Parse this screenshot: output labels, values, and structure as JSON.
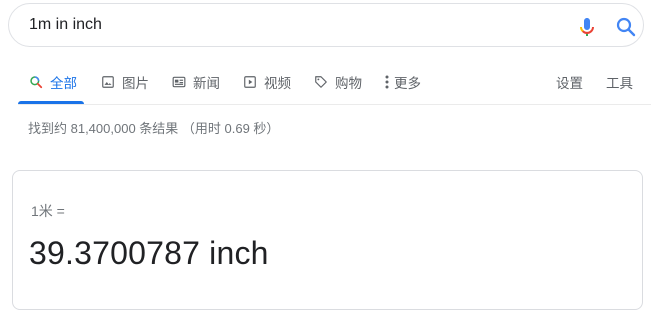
{
  "search": {
    "query": "1m in inch"
  },
  "tabs": [
    {
      "label": "全部",
      "icon": "search-icon",
      "active": true
    },
    {
      "label": "图片",
      "icon": "image-icon"
    },
    {
      "label": "新闻",
      "icon": "news-icon"
    },
    {
      "label": "视频",
      "icon": "video-icon"
    },
    {
      "label": "购物",
      "icon": "tag-icon"
    },
    {
      "label": "更多",
      "icon": "more-vert-icon"
    }
  ],
  "tools": {
    "settings": "设置",
    "tools": "工具"
  },
  "result_stats": "找到约 81,400,000 条结果 （用时 0.69 秒）",
  "converter": {
    "from": "1米 =",
    "result": "39.3700787 inch"
  },
  "colors": {
    "accent": "#1a73e8",
    "text": "#202124",
    "muted": "#70757a",
    "mic_blue": "#4285f4",
    "mic_red": "#ea4335",
    "mic_yellow": "#fbbc05",
    "mic_green": "#34a853"
  }
}
